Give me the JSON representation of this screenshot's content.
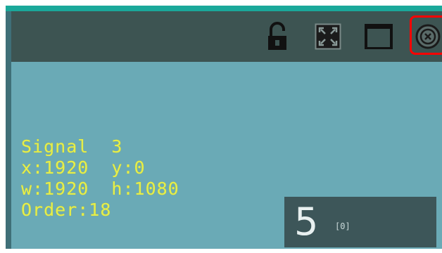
{
  "info": {
    "signal": "Signal  3",
    "position": "x:1920  y:0",
    "size": "w:1920  h:1080",
    "order": "Order:18"
  },
  "panel": {
    "number": "5",
    "sub_label": "[0]"
  },
  "toolbar": {
    "icons": [
      "unlock-icon",
      "fit-screen-icon",
      "window-icon",
      "close-circle-icon"
    ]
  },
  "colors": {
    "background": "#6aaab6",
    "toolbar": "#3d5452",
    "accent": "#1aa89a",
    "text": "#e6ee4a",
    "highlight": "#ff0000"
  }
}
